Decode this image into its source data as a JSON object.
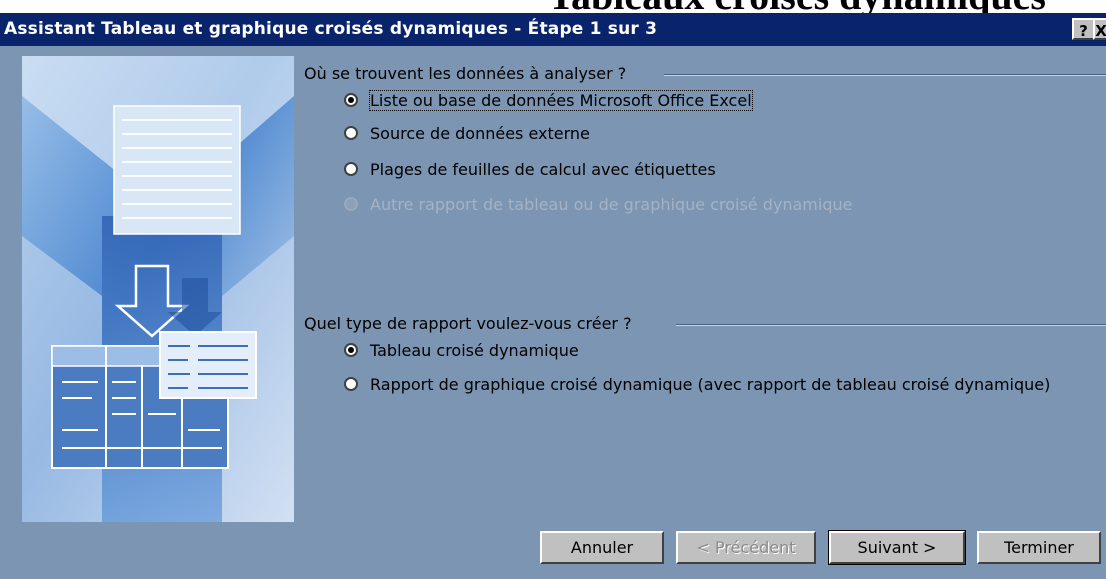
{
  "page_header": {
    "cut_text": "Tableaux croisés dynamiques"
  },
  "window": {
    "title": "Assistant Tableau et graphique croisés dynamiques - Étape 1 sur 3",
    "help_label": "?",
    "close_label": "X"
  },
  "section_source": {
    "title": "Où se trouvent les données à analyser ?",
    "options": [
      {
        "label": "Liste ou base de données Microsoft Office Excel",
        "checked": true,
        "enabled": true
      },
      {
        "label": "Source de données externe",
        "checked": false,
        "enabled": true
      },
      {
        "label": "Plages de feuilles de calcul avec étiquettes",
        "checked": false,
        "enabled": true
      },
      {
        "label": "Autre rapport de tableau ou de graphique croisé dynamique",
        "checked": false,
        "enabled": false
      }
    ]
  },
  "section_report": {
    "title": "Quel type de rapport voulez-vous créer ?",
    "options": [
      {
        "label": "Tableau croisé dynamique",
        "checked": true,
        "enabled": true
      },
      {
        "label": "Rapport de graphique croisé dynamique (avec rapport de tableau croisé dynamique)",
        "checked": false,
        "enabled": true
      }
    ]
  },
  "buttons": {
    "cancel": "Annuler",
    "previous": "< Précédent",
    "next": "Suivant >",
    "finish": "Terminer"
  }
}
